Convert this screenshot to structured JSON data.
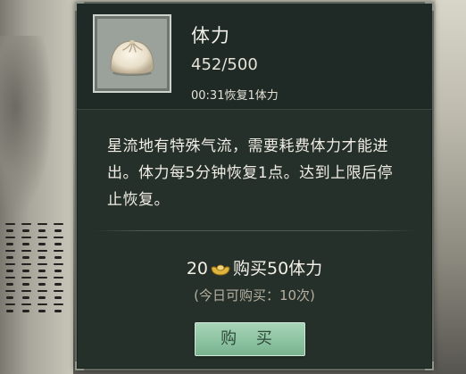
{
  "item": {
    "name": "体力",
    "amount": "452/500",
    "recover_text": "00:31恢复1体力",
    "icon": "steamed-bun-icon"
  },
  "description": "星流地有特殊气流，需要耗费体力才能进出。体力每5分钟恢复1点。达到上限后停止恢复。",
  "purchase": {
    "cost": "20",
    "currency_icon": "gold-ingot-icon",
    "buy_text": "购买50体力",
    "limit_text": "(今日可购买：10次)",
    "button_label": "购 买"
  },
  "colors": {
    "panel_bg": "#26302b",
    "header_bg": "#1f2925",
    "button": "#8cc3a1",
    "text": "#f2efe6"
  }
}
